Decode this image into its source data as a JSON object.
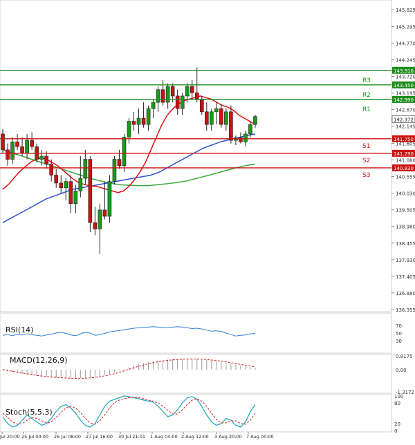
{
  "chart_data": {
    "type": "candlestick",
    "main": {
      "y_ticks": [
        "145.825",
        "145.295",
        "144.770",
        "144.245",
        "143.720",
        "143.195",
        "142.670",
        "142.145",
        "141.605",
        "141.080",
        "140.555",
        "140.030",
        "139.505",
        "138.980",
        "138.455",
        "137.930",
        "137.405",
        "136.880",
        "136.355"
      ],
      "ylim": [
        136.355,
        146.0
      ],
      "levels": [
        {
          "name": "R3",
          "value": 143.91,
          "label": "143.910",
          "color": "#1e8c1e"
        },
        {
          "name": "R2",
          "value": 143.45,
          "label": "143.450",
          "color": "#1e8c1e"
        },
        {
          "name": "R1",
          "value": 142.99,
          "label": "142.990",
          "color": "#1e8c1e"
        },
        {
          "name": "S1",
          "value": 141.75,
          "label": "141.750",
          "color": "#cc1111"
        },
        {
          "name": "S2",
          "value": 141.29,
          "label": "141.290",
          "color": "#cc1111"
        },
        {
          "name": "S3",
          "value": 140.83,
          "label": "140.830",
          "color": "#cc1111"
        }
      ],
      "last_price": {
        "value": 142.372,
        "label": "142.372"
      },
      "candles": [
        [
          141.9,
          142.05,
          141.3,
          141.4
        ],
        [
          141.4,
          141.6,
          140.9,
          141.1
        ],
        [
          141.1,
          141.8,
          140.95,
          141.65
        ],
        [
          141.65,
          141.9,
          141.4,
          141.5
        ],
        [
          141.5,
          141.8,
          141.2,
          141.3
        ],
        [
          141.3,
          141.9,
          141.1,
          141.7
        ],
        [
          141.7,
          141.95,
          141.4,
          141.5
        ],
        [
          141.5,
          141.6,
          141.0,
          141.1
        ],
        [
          141.1,
          141.4,
          140.9,
          141.2
        ],
        [
          141.2,
          141.35,
          140.8,
          140.95
        ],
        [
          140.95,
          141.1,
          140.4,
          140.6
        ],
        [
          140.6,
          140.8,
          140.2,
          140.35
        ],
        [
          140.35,
          140.6,
          140.0,
          140.2
        ],
        [
          140.2,
          140.5,
          139.8,
          140.4
        ],
        [
          140.4,
          140.6,
          139.4,
          139.7
        ],
        [
          139.7,
          140.3,
          139.4,
          140.1
        ],
        [
          140.1,
          141.2,
          139.9,
          140.5
        ],
        [
          140.5,
          141.4,
          140.3,
          141.1
        ],
        [
          141.1,
          141.2,
          138.8,
          139.1
        ],
        [
          139.1,
          139.6,
          138.7,
          138.9
        ],
        [
          138.9,
          139.7,
          138.1,
          139.5
        ],
        [
          139.5,
          140.4,
          139.2,
          139.3
        ],
        [
          139.3,
          140.6,
          139.1,
          140.4
        ],
        [
          140.4,
          141.2,
          140.3,
          141.1
        ],
        [
          141.1,
          141.4,
          140.8,
          140.9
        ],
        [
          140.9,
          141.9,
          140.7,
          141.8
        ],
        [
          141.8,
          142.4,
          141.6,
          142.3
        ],
        [
          142.3,
          142.6,
          142.0,
          142.2
        ],
        [
          142.2,
          142.7,
          141.9,
          142.4
        ],
        [
          142.4,
          142.9,
          142.1,
          142.2
        ],
        [
          142.2,
          142.8,
          142.0,
          142.7
        ],
        [
          142.7,
          143.0,
          142.4,
          142.9
        ],
        [
          142.9,
          143.4,
          142.6,
          143.3
        ],
        [
          143.3,
          143.6,
          142.8,
          142.9
        ],
        [
          142.9,
          143.5,
          142.7,
          143.4
        ],
        [
          143.4,
          143.5,
          142.9,
          143.1
        ],
        [
          143.1,
          143.3,
          142.5,
          142.7
        ],
        [
          142.7,
          143.2,
          142.5,
          143.1
        ],
        [
          143.1,
          143.5,
          142.9,
          143.4
        ],
        [
          143.4,
          143.6,
          143.0,
          143.2
        ],
        [
          143.2,
          144.0,
          142.9,
          143.0
        ],
        [
          143.0,
          143.1,
          142.5,
          142.6
        ],
        [
          142.6,
          142.9,
          142.0,
          142.2
        ],
        [
          142.2,
          142.7,
          142.0,
          142.6
        ],
        [
          142.6,
          142.9,
          142.2,
          142.7
        ],
        [
          142.7,
          142.85,
          142.1,
          142.2
        ],
        [
          142.2,
          142.7,
          142.0,
          142.6
        ],
        [
          142.6,
          142.8,
          141.6,
          141.7
        ],
        [
          141.7,
          141.85,
          141.55,
          141.78
        ],
        [
          141.78,
          141.95,
          141.6,
          141.65
        ],
        [
          141.65,
          142.0,
          141.5,
          141.9
        ],
        [
          141.9,
          142.3,
          141.8,
          142.2
        ],
        [
          142.2,
          142.5,
          142.1,
          142.45
        ]
      ],
      "ma_red": [
        140.15,
        140.3,
        140.5,
        140.7,
        140.85,
        141.0,
        141.1,
        141.15,
        141.1,
        141.0,
        140.9,
        140.75,
        140.6,
        140.45,
        140.35,
        140.3,
        140.25,
        140.25,
        140.2,
        140.15,
        140.1,
        140.05,
        140.1,
        140.25,
        140.45,
        140.7,
        141.0,
        141.4,
        141.8,
        142.2,
        142.5,
        142.7,
        142.85,
        142.95,
        143.0,
        143.05,
        143.1,
        143.05,
        143.0,
        142.9,
        142.8,
        142.75,
        142.65,
        142.5,
        142.4,
        142.3,
        142.2
      ],
      "ma_blue": [
        139.1,
        139.25,
        139.4,
        139.55,
        139.7,
        139.85,
        139.95,
        140.05,
        140.15,
        140.2,
        140.25,
        140.3,
        140.35,
        140.4,
        140.45,
        140.5,
        140.55,
        140.6,
        140.7,
        140.85,
        141.0,
        141.15,
        141.3,
        141.45,
        141.55,
        141.65,
        141.72,
        141.78,
        141.85,
        141.9
      ],
      "ma_green": [
        141.4,
        141.3,
        141.2,
        141.1,
        141.0,
        140.9,
        140.8,
        140.7,
        140.6,
        140.5,
        140.42,
        140.35,
        140.3,
        140.28,
        140.27,
        140.27,
        140.3,
        140.33,
        140.37,
        140.42,
        140.5,
        140.58,
        140.66,
        140.75,
        140.83,
        140.9,
        140.95
      ],
      "last_price_tag": "142.372"
    },
    "x_labels": [
      "Jul 20:00",
      "25 Jul 00:00",
      "26 Jul 08:00",
      "27 Jul 16:00",
      "30 Jul 21:01",
      "1 Aug 04:00",
      "2 Aug 12:00",
      "3 Aug 20:00",
      "7 Aug 00:00"
    ],
    "rsi": {
      "label": "RSI(14)",
      "ticks": [
        "70",
        "50",
        "30"
      ],
      "values": [
        44,
        46,
        43,
        47,
        45,
        48,
        46,
        44,
        42,
        45,
        47,
        50,
        52,
        49,
        45,
        43,
        48,
        52,
        50,
        44,
        46,
        49,
        53,
        55,
        57,
        59,
        61,
        63,
        64,
        65,
        66,
        67,
        66,
        65,
        64,
        66,
        67,
        66,
        64,
        62,
        63,
        61,
        58,
        55,
        56,
        54,
        50,
        46,
        42,
        44,
        45,
        48,
        49
      ]
    },
    "macd": {
      "label": "MACD(12,26,9)",
      "ticks": [
        "0.8175",
        "0.00",
        "-1.3172"
      ],
      "hist": [
        -0.05,
        -0.1,
        -0.15,
        -0.2,
        -0.25,
        -0.3,
        -0.35,
        -0.4,
        -0.42,
        -0.45,
        -0.47,
        -0.48,
        -0.5,
        -0.52,
        -0.53,
        -0.52,
        -0.5,
        -0.48,
        -0.45,
        -0.42,
        -0.38,
        -0.32,
        -0.25,
        -0.15,
        -0.05,
        0.05,
        0.15,
        0.25,
        0.33,
        0.4,
        0.45,
        0.5,
        0.55,
        0.58,
        0.6,
        0.62,
        0.63,
        0.64,
        0.64,
        0.63,
        0.62,
        0.6,
        0.57,
        0.53,
        0.5,
        0.46,
        0.42,
        0.36,
        0.3,
        0.25,
        0.2,
        0.16,
        0.12
      ],
      "signal": [
        0.0,
        -0.05,
        -0.1,
        -0.15,
        -0.2,
        -0.25,
        -0.3,
        -0.34,
        -0.38,
        -0.41,
        -0.44,
        -0.46,
        -0.48,
        -0.5,
        -0.51,
        -0.52,
        -0.52,
        -0.51,
        -0.49,
        -0.46,
        -0.42,
        -0.37,
        -0.31,
        -0.24,
        -0.16,
        -0.07,
        0.02,
        0.11,
        0.2,
        0.28,
        0.35,
        0.41,
        0.47,
        0.51,
        0.55,
        0.58,
        0.6,
        0.62,
        0.63,
        0.63,
        0.63,
        0.62,
        0.6,
        0.57,
        0.54,
        0.5,
        0.46,
        0.41,
        0.36,
        0.31,
        0.26,
        0.21,
        0.17
      ]
    },
    "stoch": {
      "label": "Stoch(5,5,3)",
      "ticks": [
        "100",
        "80",
        "20",
        "0"
      ],
      "k": [
        40,
        20,
        10,
        15,
        30,
        45,
        35,
        25,
        15,
        20,
        35,
        55,
        70,
        75,
        65,
        50,
        30,
        15,
        10,
        20,
        45,
        70,
        85,
        90,
        95,
        100,
        98,
        95,
        92,
        88,
        85,
        82,
        70,
        55,
        40,
        45,
        60,
        80,
        95,
        98,
        90,
        70,
        45,
        25,
        15,
        20,
        35,
        30,
        15,
        10,
        25,
        55,
        75
      ],
      "d": [
        50,
        38,
        25,
        18,
        20,
        30,
        38,
        35,
        28,
        22,
        25,
        38,
        52,
        65,
        70,
        65,
        52,
        35,
        22,
        18,
        28,
        45,
        65,
        80,
        88,
        92,
        95,
        96,
        95,
        92,
        88,
        85,
        80,
        70,
        58,
        48,
        48,
        60,
        75,
        88,
        92,
        85,
        70,
        50,
        32,
        22,
        22,
        28,
        28,
        20,
        18,
        30,
        50
      ]
    }
  }
}
